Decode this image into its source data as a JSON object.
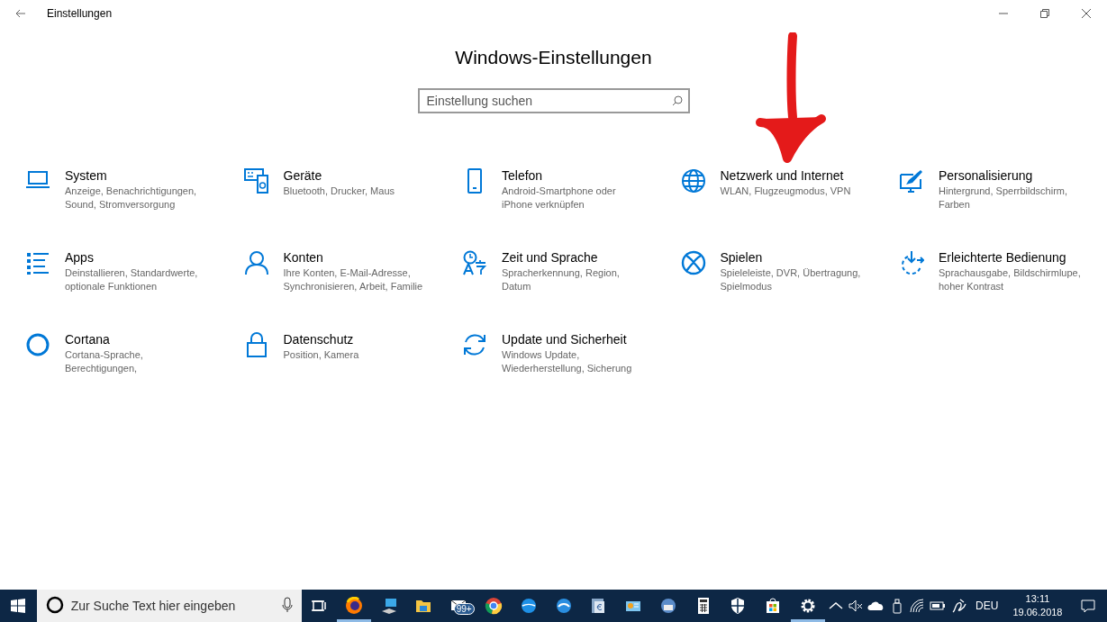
{
  "window": {
    "title": "Einstellungen"
  },
  "heading": "Windows-Einstellungen",
  "search": {
    "placeholder": "Einstellung suchen"
  },
  "tiles": [
    {
      "title": "System",
      "description": "Anzeige, Benachrichtigungen, Sound, Stromversorgung"
    },
    {
      "title": "Geräte",
      "description": "Bluetooth, Drucker, Maus"
    },
    {
      "title": "Telefon",
      "description": "Android-Smartphone oder iPhone verknüpfen"
    },
    {
      "title": "Netzwerk und Internet",
      "description": "WLAN, Flugzeugmodus, VPN"
    },
    {
      "title": "Personalisierung",
      "description": "Hintergrund, Sperrbildschirm, Farben"
    },
    {
      "title": "Apps",
      "description": "Deinstallieren, Standardwerte, optionale Funktionen"
    },
    {
      "title": "Konten",
      "description": "Ihre Konten, E-Mail-Adresse, Synchronisieren, Arbeit, Familie"
    },
    {
      "title": "Zeit und Sprache",
      "description": "Spracherkennung, Region, Datum"
    },
    {
      "title": "Spielen",
      "description": "Spieleleiste, DVR, Übertragung, Spielmodus"
    },
    {
      "title": "Erleichterte Bedienung",
      "description": "Sprachausgabe, Bildschirmlupe, hoher Kontrast"
    },
    {
      "title": "Cortana",
      "description": "Cortana-Sprache, Berechtigungen,"
    },
    {
      "title": "Datenschutz",
      "description": "Position, Kamera"
    },
    {
      "title": "Update und Sicherheit",
      "description": "Windows Update, Wiederherstellung, Sicherung"
    }
  ],
  "taskbar": {
    "search_placeholder": "Zur Suche Text hier eingeben",
    "apps": [
      {
        "active": false
      },
      {
        "active": true
      },
      {
        "active": false
      },
      {
        "active": false
      },
      {
        "active": false,
        "badge": "99+"
      },
      {
        "active": false
      },
      {
        "active": false
      },
      {
        "active": false
      },
      {
        "active": false
      },
      {
        "active": false
      },
      {
        "active": false
      },
      {
        "active": false
      },
      {
        "active": false
      },
      {
        "active": false
      },
      {
        "active": true
      }
    ],
    "language": "DEU",
    "time": "13:11",
    "date": "19.06.2018"
  }
}
